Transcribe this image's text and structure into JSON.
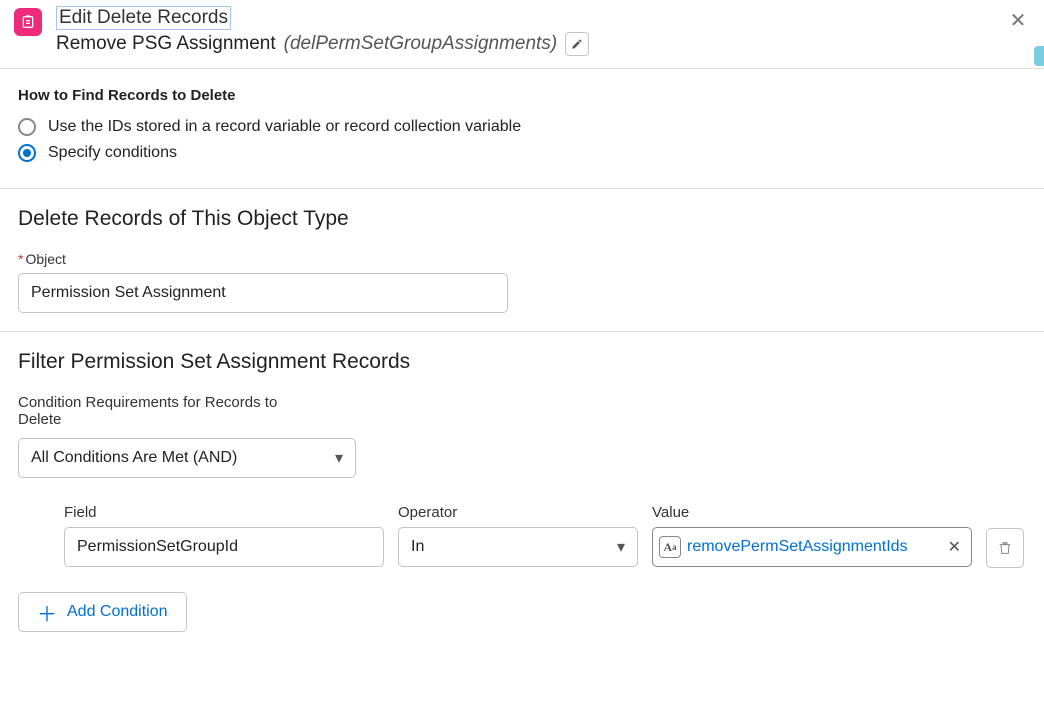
{
  "header": {
    "title": "Edit Delete Records",
    "subtitle_label": "Remove PSG Assignment",
    "api_name": "(delPermSetGroupAssignments)"
  },
  "find_section": {
    "heading": "How to Find Records to Delete",
    "options": {
      "use_ids": "Use the IDs stored in a record variable or record collection variable",
      "specify": "Specify conditions"
    }
  },
  "object_section": {
    "heading": "Delete Records of This Object Type",
    "object_label": "Object",
    "object_value": "Permission Set Assignment"
  },
  "filter_section": {
    "heading": "Filter Permission Set Assignment Records",
    "cond_label": "Condition Requirements for Records to Delete",
    "cond_value": "All Conditions Are Met (AND)",
    "columns": {
      "field": "Field",
      "operator": "Operator",
      "value": "Value"
    },
    "row": {
      "field": "PermissionSetGroupId",
      "operator": "In",
      "value_resource": "removePermSetAssignmentIds"
    },
    "add_condition": "Add Condition"
  }
}
